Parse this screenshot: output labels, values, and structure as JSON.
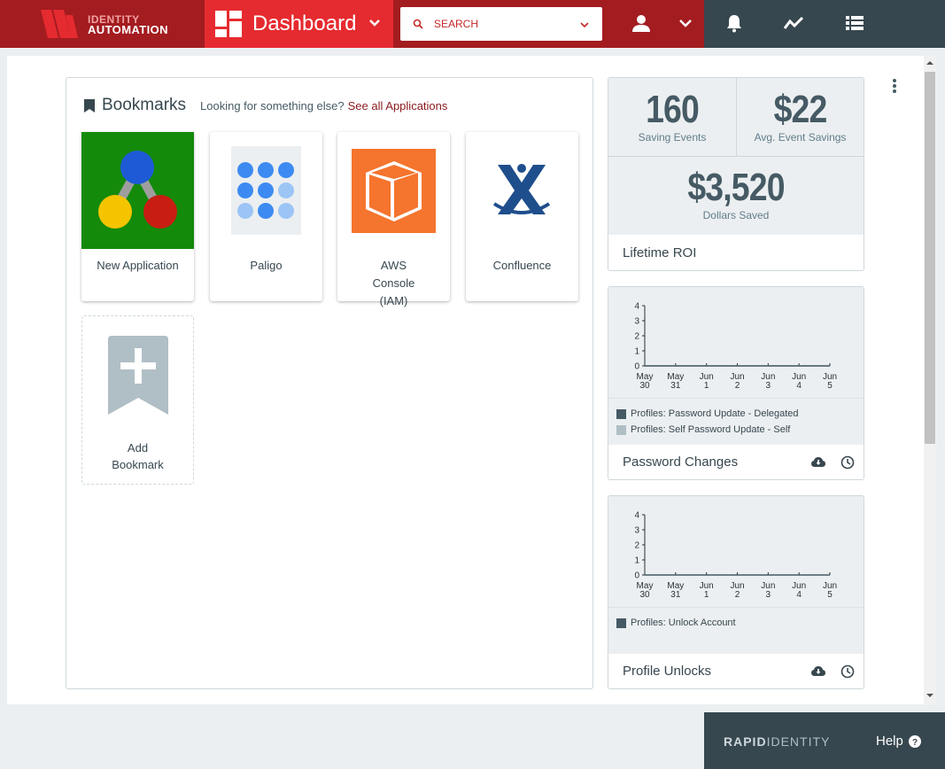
{
  "header": {
    "logo_line1": "IDENTITY",
    "logo_line2": "AUTOMATION",
    "dashboard_title": "Dashboard",
    "search_placeholder": "SEARCH"
  },
  "bookmarks": {
    "title": "Bookmarks",
    "subtitle": "Looking for something else?",
    "link": "See all Applications",
    "tiles": [
      {
        "label": "New Application"
      },
      {
        "label": "Paligo"
      },
      {
        "label": "AWS Console (IAM)"
      },
      {
        "label": "Confluence"
      }
    ],
    "add_label_1": "Add",
    "add_label_2": "Bookmark"
  },
  "roi": {
    "saving_events_value": "160",
    "saving_events_label": "Saving Events",
    "avg_savings_value": "$22",
    "avg_savings_label": "Avg. Event Savings",
    "dollars_saved_value": "$3,520",
    "dollars_saved_label": "Dollars Saved",
    "footer": "Lifetime ROI"
  },
  "password_changes": {
    "title": "Password Changes",
    "legend": [
      "Profiles: Password Update - Delegated",
      "Profiles: Self Password Update - Self"
    ]
  },
  "profile_unlocks": {
    "title": "Profile Unlocks",
    "legend": [
      "Profiles: Unlock Account"
    ]
  },
  "chart_data": [
    {
      "type": "line",
      "x": [
        "May 30",
        "May 31",
        "Jun 1",
        "Jun 2",
        "Jun 3",
        "Jun 4",
        "Jun 5"
      ],
      "series": [
        {
          "name": "Profiles: Password Update - Delegated",
          "values": [
            0,
            0,
            0,
            0,
            0,
            0,
            0
          ],
          "color": "#455a64"
        },
        {
          "name": "Profiles: Self Password Update - Self",
          "values": [
            0,
            0,
            0,
            0,
            0,
            0,
            0
          ],
          "color": "#b0bec5"
        }
      ],
      "yticks": [
        "0",
        "1",
        "2",
        "3",
        "4"
      ],
      "ylim": [
        0,
        4
      ]
    },
    {
      "type": "line",
      "x": [
        "May 30",
        "May 31",
        "Jun 1",
        "Jun 2",
        "Jun 3",
        "Jun 4",
        "Jun 5"
      ],
      "series": [
        {
          "name": "Profiles: Unlock Account",
          "values": [
            0,
            0,
            0,
            0,
            0,
            0,
            0
          ],
          "color": "#455a64"
        }
      ],
      "yticks": [
        "0",
        "1",
        "2",
        "3",
        "4"
      ],
      "ylim": [
        0,
        4
      ]
    }
  ],
  "bottom": {
    "brand_bold": "RAPID",
    "brand_rest": "IDENTITY",
    "help": "Help"
  }
}
